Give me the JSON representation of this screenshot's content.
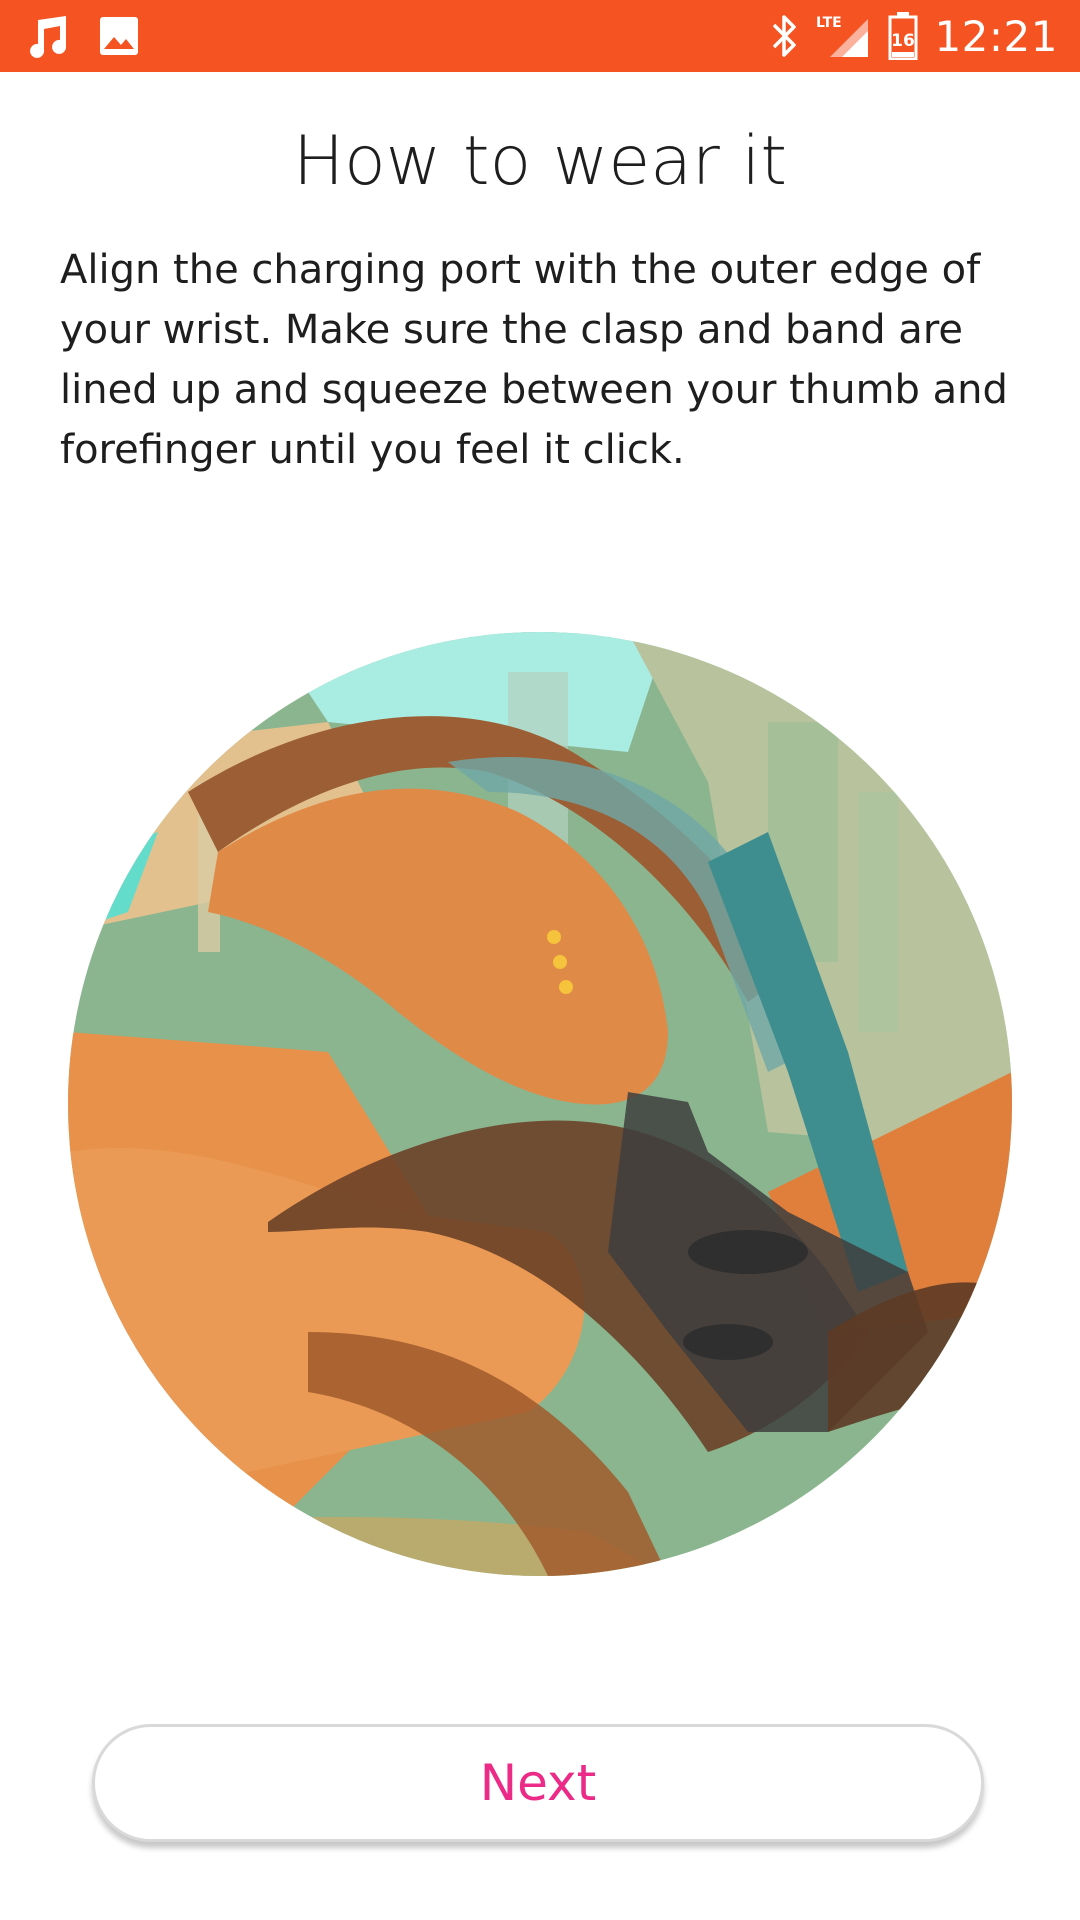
{
  "status_bar": {
    "time": "12:21",
    "battery_level": "16",
    "network": "LTE",
    "left_icons": [
      "music-note-icon",
      "image-icon"
    ],
    "right_icons": [
      "bluetooth-icon",
      "lte-signal-icon",
      "battery-icon"
    ],
    "color": "#f55322"
  },
  "page": {
    "title": "How to wear it",
    "description": "Align the charging port with the outer edge of your wrist. Make sure the clasp and band are lined up and squeeze between your thumb and forefinger until you feel it click."
  },
  "actions": {
    "next_label": "Next",
    "next_color": "#ec2a87"
  }
}
